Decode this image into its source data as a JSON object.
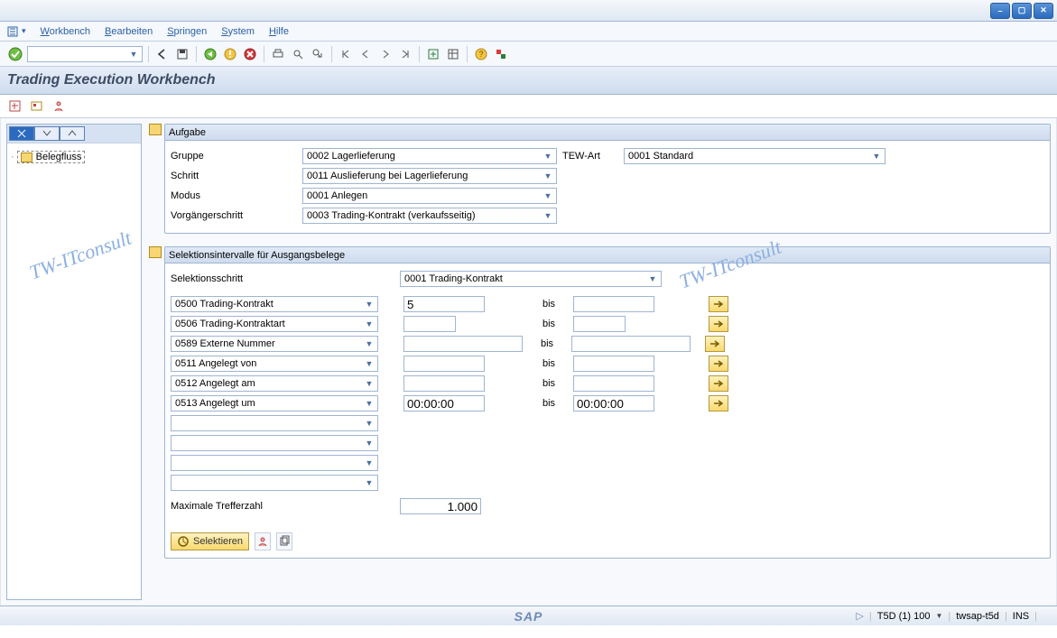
{
  "window_controls": [
    "–",
    "▢",
    "✕"
  ],
  "menu": [
    "Workbench",
    "Bearbeiten",
    "Springen",
    "System",
    "Hilfe"
  ],
  "title": "Trading Execution Workbench",
  "tree_item": "Belegfluss",
  "watermark": "TW-ITconsult",
  "aufgabe": {
    "header": "Aufgabe",
    "gruppe_label": "Gruppe",
    "gruppe_value": "0002 Lagerlieferung",
    "schritt_label": "Schritt",
    "schritt_value": "0011 Auslieferung bei Lagerlieferung",
    "modus_label": "Modus",
    "modus_value": "0001 Anlegen",
    "vorgaenger_label": "Vorgängerschritt",
    "vorgaenger_value": "0003 Trading-Kontrakt (verkaufsseitig)",
    "tewart_label": "TEW-Art",
    "tewart_value": "0001 Standard"
  },
  "selektion": {
    "header": "Selektionsintervalle für Ausgangsbelege",
    "schritt_label": "Selektionsschritt",
    "schritt_value": "0001 Trading-Kontrakt",
    "bis": "bis",
    "rows": [
      {
        "label": "0500 Trading-Kontrakt",
        "from": "5",
        "to": "",
        "from_w": "w-90",
        "to_w": "w-90"
      },
      {
        "label": "0506 Trading-Kontraktart",
        "from": "",
        "to": "",
        "from_w": "w-56",
        "to_w": "w-56"
      },
      {
        "label": "0589 Externe Nummer",
        "from": "",
        "to": "",
        "from_w": "w-132",
        "to_w": "w-132"
      },
      {
        "label": "0511 Angelegt von",
        "from": "",
        "to": "",
        "from_w": "w-90",
        "to_w": "w-90"
      },
      {
        "label": "0512 Angelegt am",
        "from": "",
        "to": "",
        "from_w": "w-90",
        "to_w": "w-90"
      },
      {
        "label": "0513 Angelegt um",
        "from": "00:00:00",
        "to": "00:00:00",
        "from_w": "w-90",
        "to_w": "w-90"
      }
    ],
    "max_label": "Maximale Trefferzahl",
    "max_value": "1.000",
    "selektieren": "Selektieren"
  },
  "status": {
    "sys": "T5D (1) 100",
    "host": "twsap-t5d",
    "mode": "INS"
  }
}
